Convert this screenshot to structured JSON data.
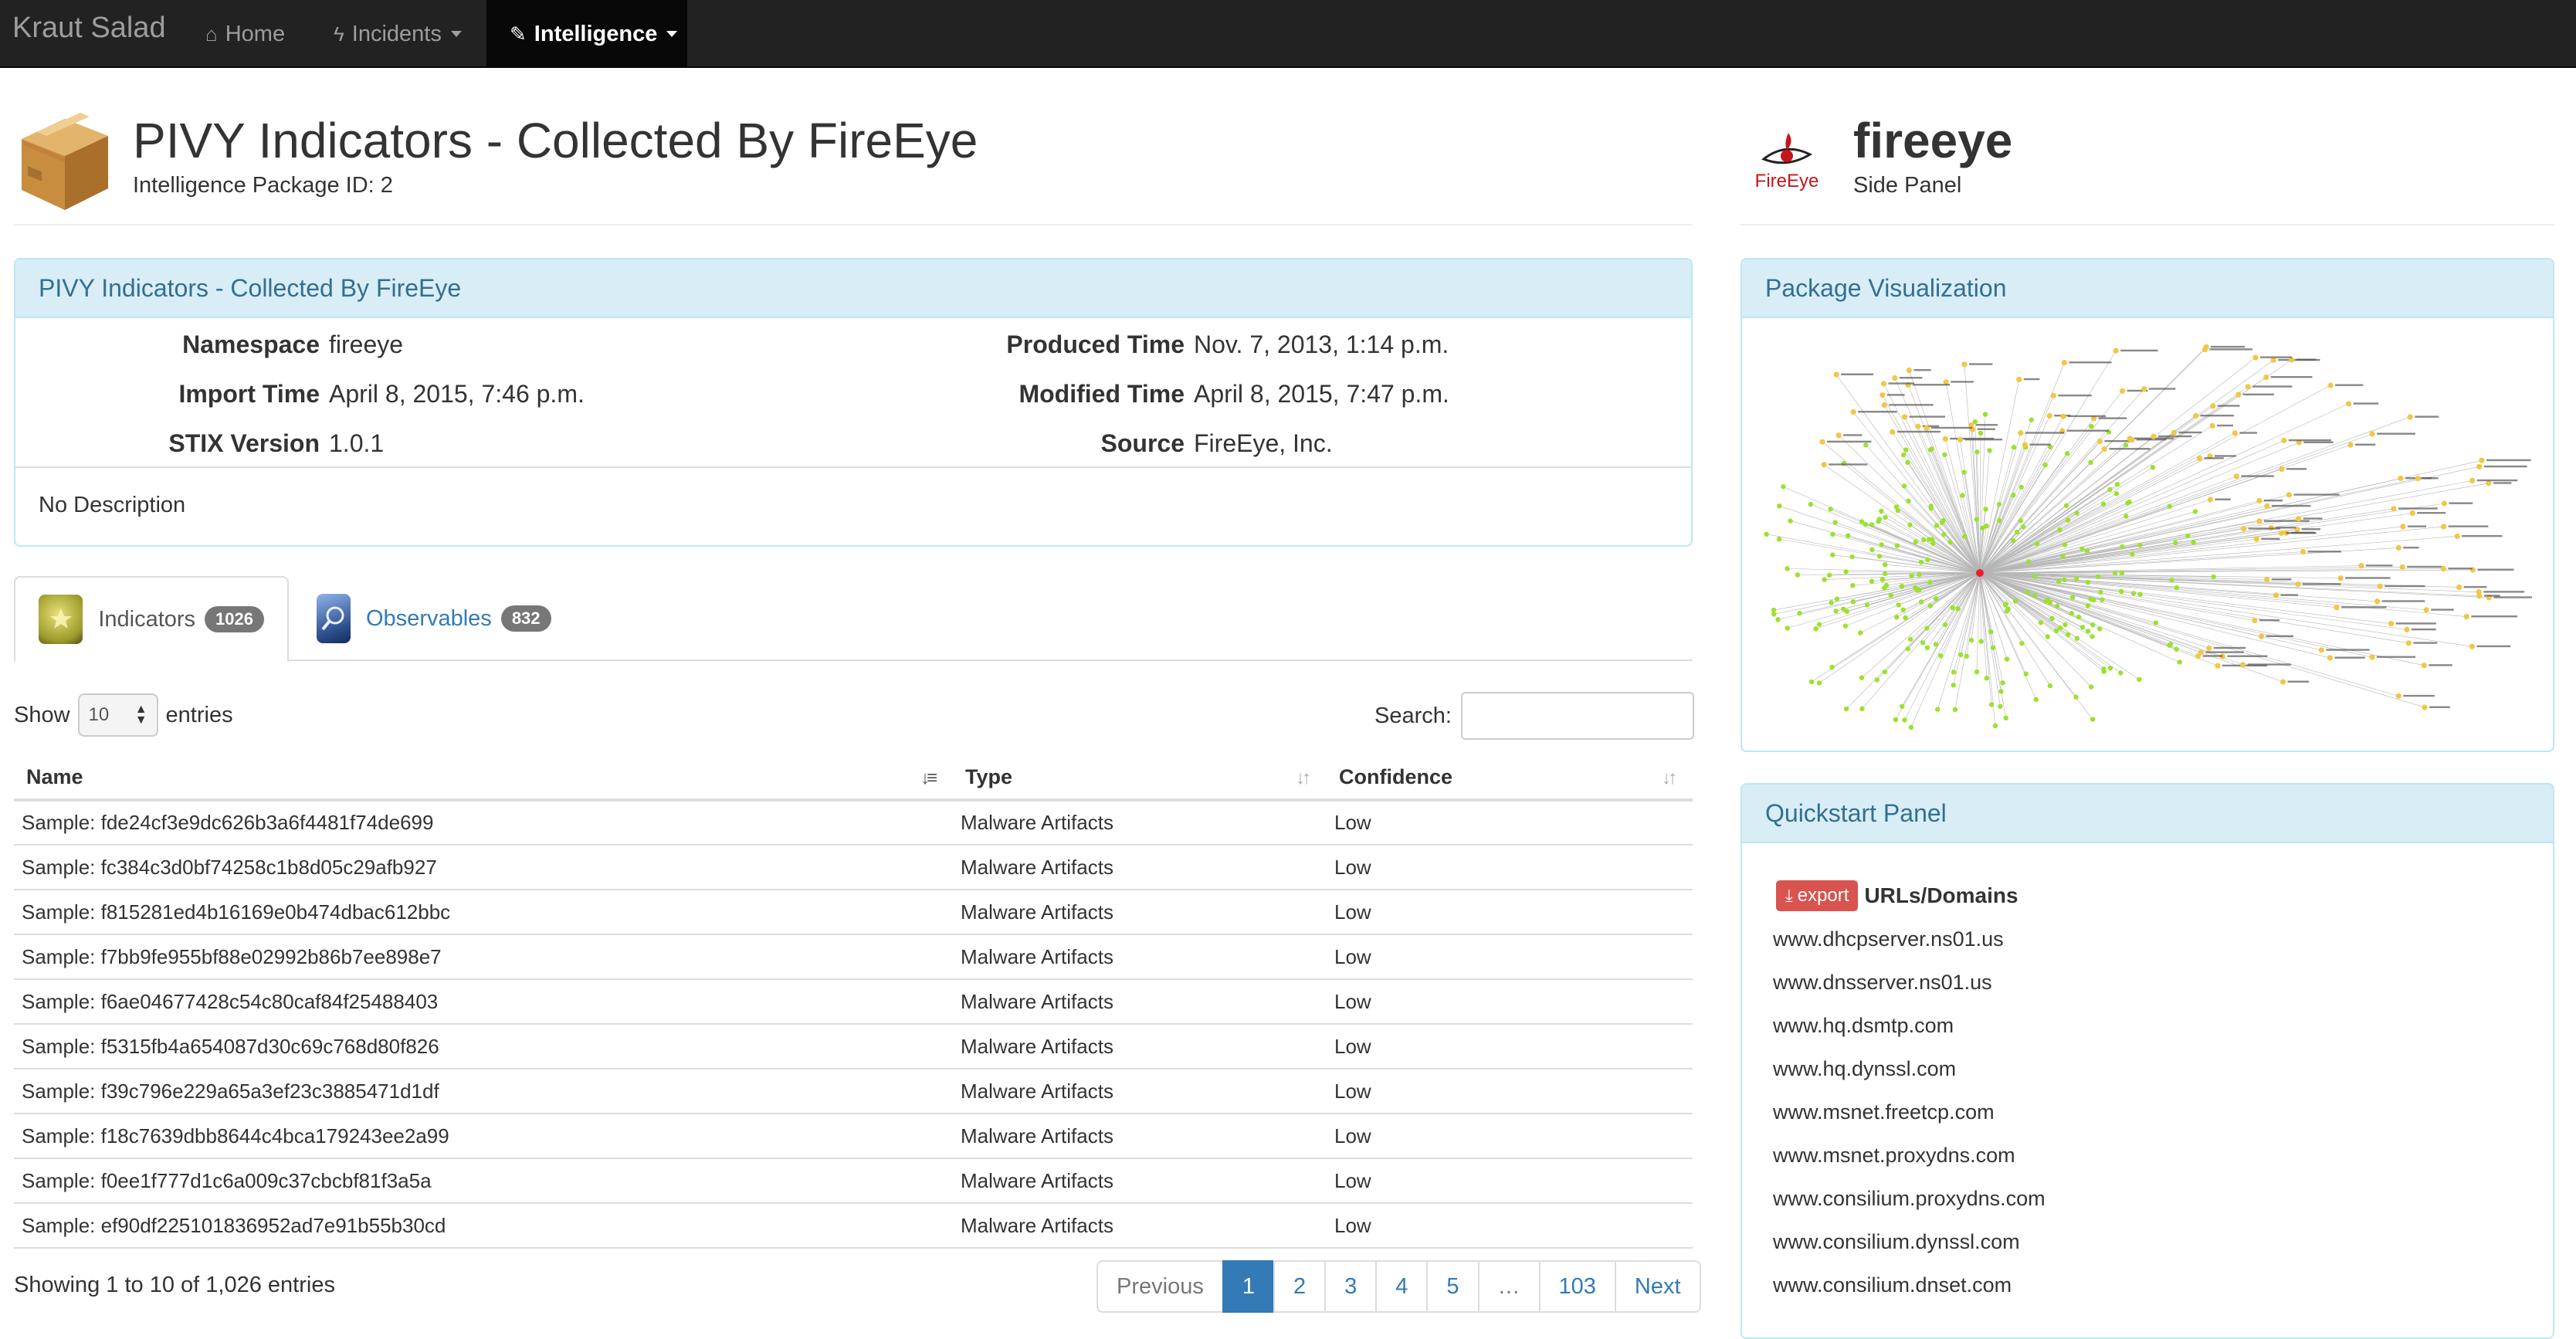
{
  "nav": {
    "brand": "Kraut Salad",
    "items": [
      {
        "label": "Home",
        "icon": "home-icon",
        "glyph": "⌂"
      },
      {
        "label": "Incidents",
        "icon": "bolt-icon",
        "glyph": "ϟ"
      },
      {
        "label": "Intelligence",
        "icon": "magic-wand-icon",
        "glyph": "✎"
      }
    ]
  },
  "header": {
    "title": "PIVY Indicators - Collected By FireEye",
    "subtitle": "Intelligence Package ID: 2"
  },
  "side_header": {
    "title": "fireeye",
    "subtitle": "Side Panel",
    "logo_text": "FireEye"
  },
  "info_panel": {
    "heading": "PIVY Indicators - Collected By FireEye",
    "fields_left": [
      {
        "label": "Namespace",
        "value": "fireeye"
      },
      {
        "label": "Import Time",
        "value": "April 8, 2015, 7:46 p.m."
      },
      {
        "label": "STIX Version",
        "value": "1.0.1"
      }
    ],
    "fields_right": [
      {
        "label": "Produced Time",
        "value": "Nov. 7, 2013, 1:14 p.m."
      },
      {
        "label": "Modified Time",
        "value": "April 8, 2015, 7:47 p.m."
      },
      {
        "label": "Source",
        "value": "FireEye, Inc."
      }
    ],
    "description": "No Description"
  },
  "tabs": [
    {
      "label": "Indicators",
      "count": "1026",
      "icon_caption": "Indicator"
    },
    {
      "label": "Observables",
      "count": "832",
      "icon_caption": "Observable"
    }
  ],
  "table_controls": {
    "show_label": "Show",
    "length_value": "10",
    "entries_label": "entries",
    "search_label": "Search:",
    "search_value": ""
  },
  "table": {
    "columns": [
      "Name",
      "Type",
      "Confidence"
    ],
    "rows": [
      [
        "Sample: fde24cf3e9dc626b3a6f4481f74de699",
        "Malware Artifacts",
        "Low"
      ],
      [
        "Sample: fc384c3d0bf74258c1b8d05c29afb927",
        "Malware Artifacts",
        "Low"
      ],
      [
        "Sample: f815281ed4b16169e0b474dbac612bbc",
        "Malware Artifacts",
        "Low"
      ],
      [
        "Sample: f7bb9fe955bf88e02992b86b7ee898e7",
        "Malware Artifacts",
        "Low"
      ],
      [
        "Sample: f6ae04677428c54c80caf84f25488403",
        "Malware Artifacts",
        "Low"
      ],
      [
        "Sample: f5315fb4a654087d30c69c768d80f826",
        "Malware Artifacts",
        "Low"
      ],
      [
        "Sample: f39c796e229a65a3ef23c3885471d1df",
        "Malware Artifacts",
        "Low"
      ],
      [
        "Sample: f18c7639dbb8644c4bca179243ee2a99",
        "Malware Artifacts",
        "Low"
      ],
      [
        "Sample: f0ee1f777d1c6a009c37cbcbf81f3a5a",
        "Malware Artifacts",
        "Low"
      ],
      [
        "Sample: ef90df225101836952ad7e91b55b30cd",
        "Malware Artifacts",
        "Low"
      ]
    ],
    "info": "Showing 1 to 10 of 1,026 entries"
  },
  "pagination": {
    "previous": "Previous",
    "next": "Next",
    "pages": [
      "1",
      "2",
      "3",
      "4",
      "5",
      "…",
      "103"
    ],
    "active": "1"
  },
  "viz_panel": {
    "heading": "Package Visualization"
  },
  "quickstart": {
    "heading": "Quickstart Panel",
    "export_label": "export",
    "section_title": "URLs/Domains",
    "urls": [
      "www.dhcpserver.ns01.us",
      "www.dnsserver.ns01.us",
      "www.hq.dsmtp.com",
      "www.hq.dynssl.com",
      "www.msnet.freetcp.com",
      "www.msnet.proxydns.com",
      "www.consilium.proxydns.com",
      "www.consilium.dynssl.com",
      "www.consilium.dnset.com"
    ]
  },
  "colors": {
    "navbar": "#222222",
    "panel_heading_bg": "#d9edf7",
    "panel_heading_text": "#31708f",
    "link": "#337ab7",
    "export_button": "#d9534f",
    "viz_node_green": "#9be22d",
    "viz_node_yellow": "#f2c744",
    "viz_center_red": "#e8202a"
  }
}
